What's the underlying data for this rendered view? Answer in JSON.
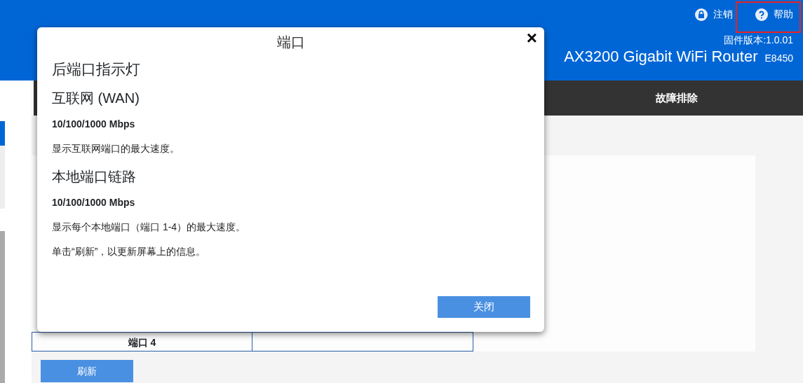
{
  "header": {
    "actions": [
      {
        "kind": "lock",
        "label": "注销"
      },
      {
        "kind": "help",
        "label": "帮助"
      }
    ],
    "firmware": "固件版本:1.0.01",
    "product": "AX3200 Gigabit WiFi Router",
    "model": "E8450"
  },
  "nav": {
    "items": [
      {
        "label": "故障排除"
      }
    ]
  },
  "sidebar": {
    "items": [
      {
        "selected": true
      },
      {
        "selected": false
      }
    ]
  },
  "table": {
    "rows": [
      {
        "cells": [
          "端口 4"
        ]
      }
    ]
  },
  "refresh_button": "刷新",
  "dialog": {
    "title": "端口",
    "close": "×",
    "blocks": [
      {
        "kind": "heading",
        "text": "后端口指示灯"
      },
      {
        "kind": "subheading",
        "text": "互联网 (WAN)"
      },
      {
        "kind": "bold",
        "text": "10/100/1000 Mbps"
      },
      {
        "kind": "text",
        "text": "显示互联网端口的最大速度。"
      },
      {
        "kind": "subheading",
        "text": "本地端口链路"
      },
      {
        "kind": "bold",
        "text": "10/100/1000 Mbps"
      },
      {
        "kind": "text",
        "text": "显示每个本地端口（端口 1-4）的最大速度。"
      },
      {
        "kind": "text",
        "text": "单击“刷新”，以更新屏幕上的信息。"
      }
    ],
    "button": "关闭"
  }
}
